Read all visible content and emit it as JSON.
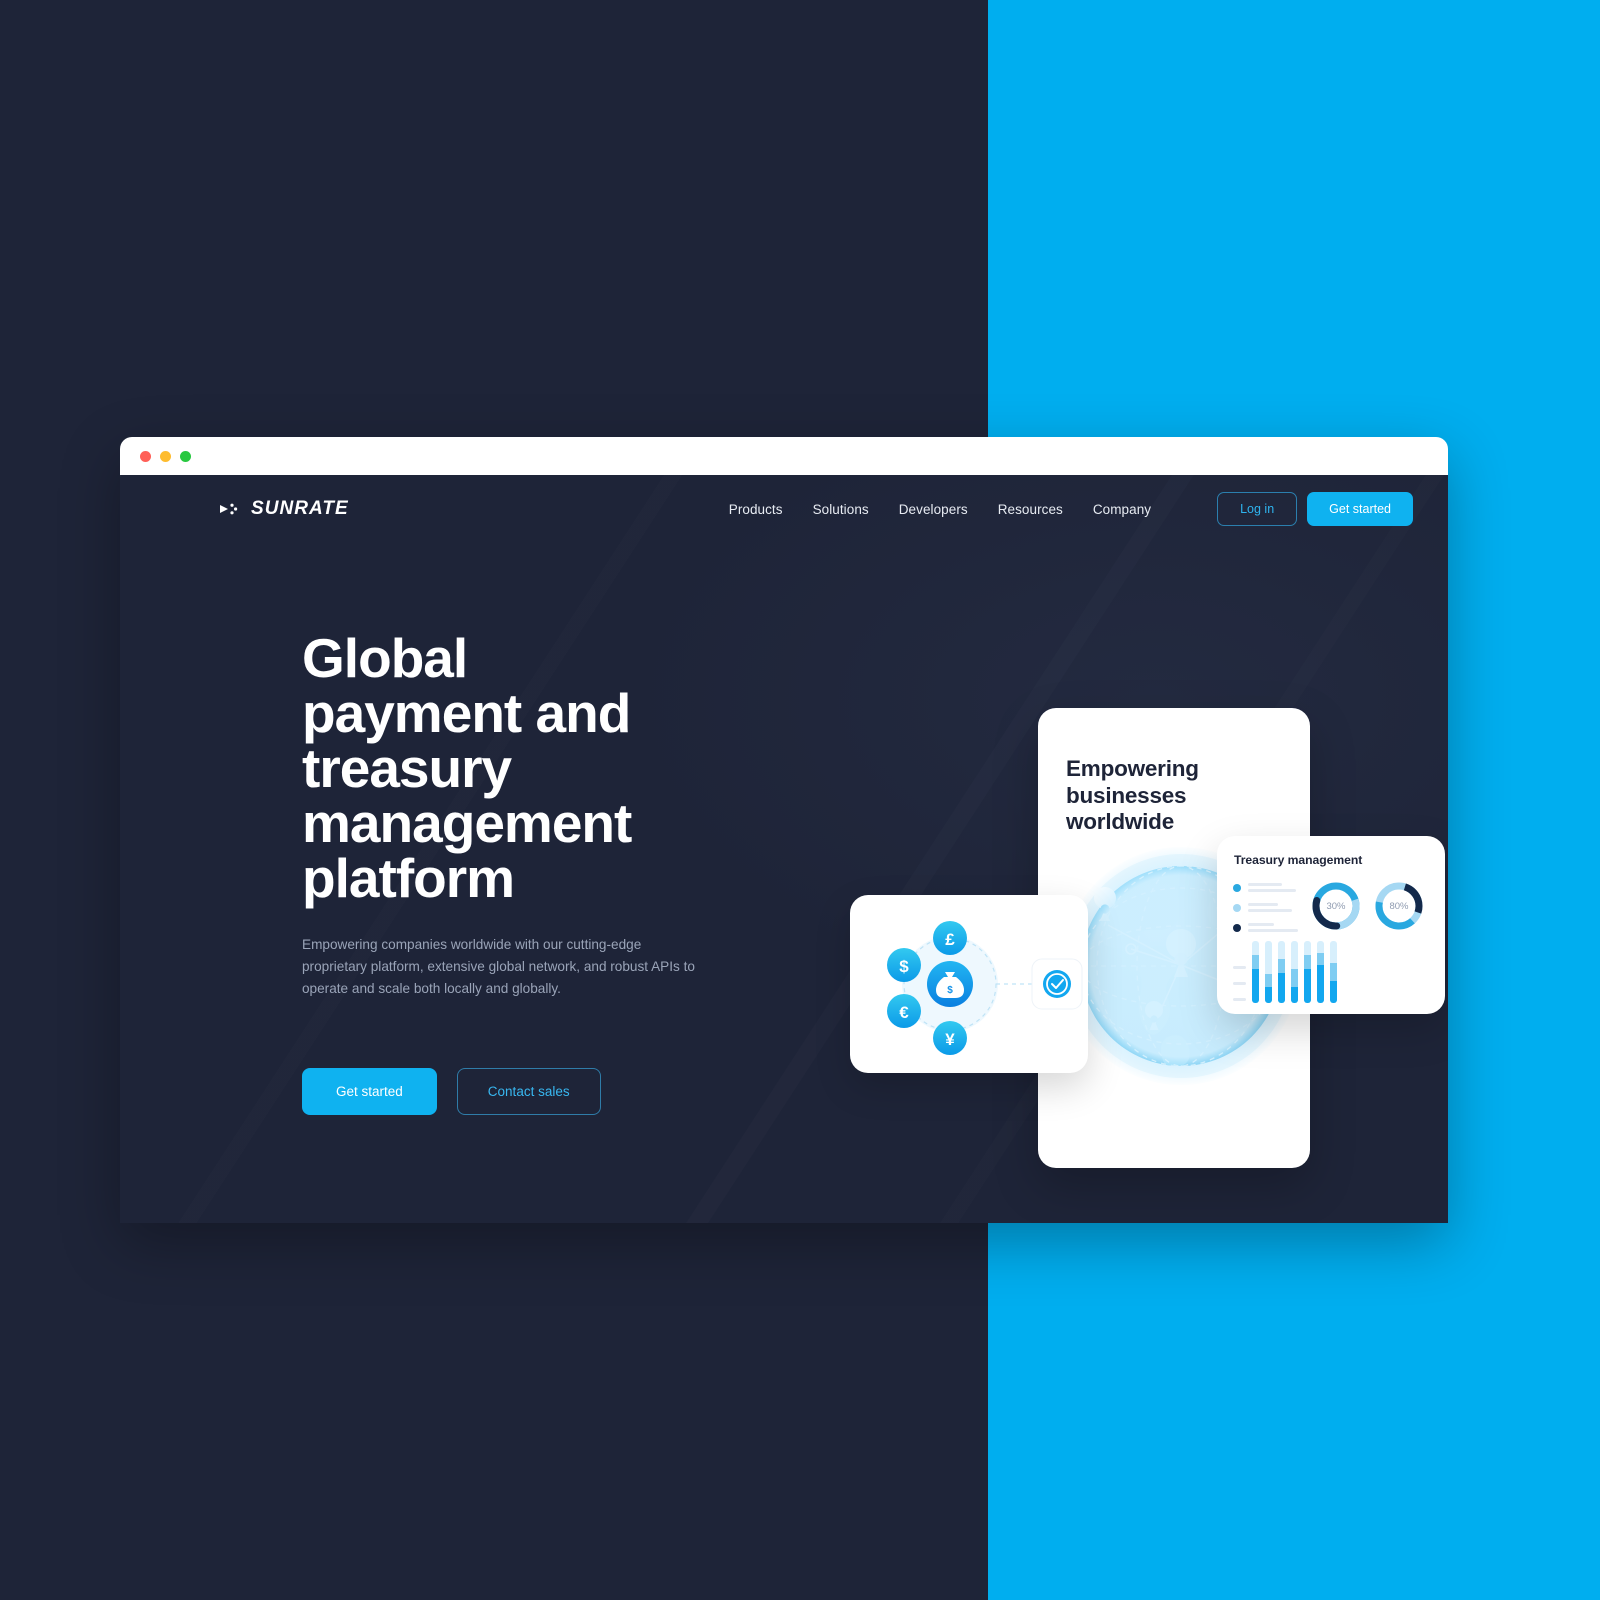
{
  "colors": {
    "navy": "#1e2438",
    "cyan": "#00aeef",
    "accent": "#0fb2f0",
    "muted": "#9aa4b8"
  },
  "window": {
    "traffic_lights": [
      "close-red",
      "minimize-yellow",
      "maximize-green"
    ]
  },
  "nav": {
    "logo_text": "SUNRATE",
    "logo_mark": "arrow-dots-icon",
    "links": [
      {
        "label": "Products"
      },
      {
        "label": "Solutions"
      },
      {
        "label": "Developers"
      },
      {
        "label": "Resources"
      },
      {
        "label": "Company"
      }
    ],
    "login_label": "Log in",
    "get_started_label": "Get started"
  },
  "hero": {
    "headline_lines": [
      "Global",
      "payment and",
      "treasury",
      "management",
      "platform"
    ],
    "subtext": "Empowering companies worldwide with our cutting-edge proprietary platform, extensive global network, and robust APIs to operate and scale both locally and globally.",
    "primary_cta": "Get started",
    "secondary_cta": "Contact sales"
  },
  "art": {
    "main_card_title_lines": [
      "Empowering",
      "businesses",
      "worldwide"
    ],
    "currency_card": {
      "center_icon": "money-bag-icon",
      "currencies": [
        {
          "symbol": "£",
          "name": "gbp-coin-icon"
        },
        {
          "symbol": "$",
          "name": "usd-coin-icon"
        },
        {
          "symbol": "€",
          "name": "eur-coin-icon"
        },
        {
          "symbol": "¥",
          "name": "jpy-coin-icon"
        }
      ],
      "status_icon": "check-circle-icon"
    },
    "globe": {
      "name": "world-globe-icon",
      "pins": 4
    },
    "treasury_card": {
      "title": "Treasury management",
      "legend": [
        {
          "color": "#29a8e0"
        },
        {
          "color": "#a5d8f3"
        },
        {
          "color": "#13294b"
        }
      ],
      "donuts": [
        {
          "label": "30%",
          "value": 30
        },
        {
          "label": "80%",
          "value": 80
        }
      ]
    }
  },
  "chart_data": [
    {
      "type": "pie",
      "title": "30%",
      "labels": [
        "filled",
        "remainder"
      ],
      "values": [
        30,
        70
      ],
      "colors": [
        "#13294b",
        "#29a8e0"
      ],
      "legend": "none"
    },
    {
      "type": "pie",
      "title": "80%",
      "labels": [
        "filled",
        "remainder"
      ],
      "values": [
        80,
        20
      ],
      "colors": [
        "#29a8e0",
        "#13294b"
      ],
      "legend": "none"
    },
    {
      "type": "bar",
      "title": "",
      "xlabel": "",
      "ylabel": "",
      "categories": [
        "1",
        "2",
        "3",
        "4",
        "5",
        "6",
        "7"
      ],
      "series": [
        {
          "name": "dark-cyan",
          "values": [
            34,
            16,
            30,
            16,
            34,
            38,
            22
          ]
        },
        {
          "name": "mid-cyan",
          "values": [
            14,
            13,
            14,
            18,
            14,
            12,
            18
          ]
        },
        {
          "name": "light-cyan",
          "values": [
            14,
            20,
            16,
            16,
            18,
            14,
            16
          ]
        }
      ],
      "ylim": [
        0,
        70
      ],
      "grid": true,
      "legend": "none"
    }
  ]
}
